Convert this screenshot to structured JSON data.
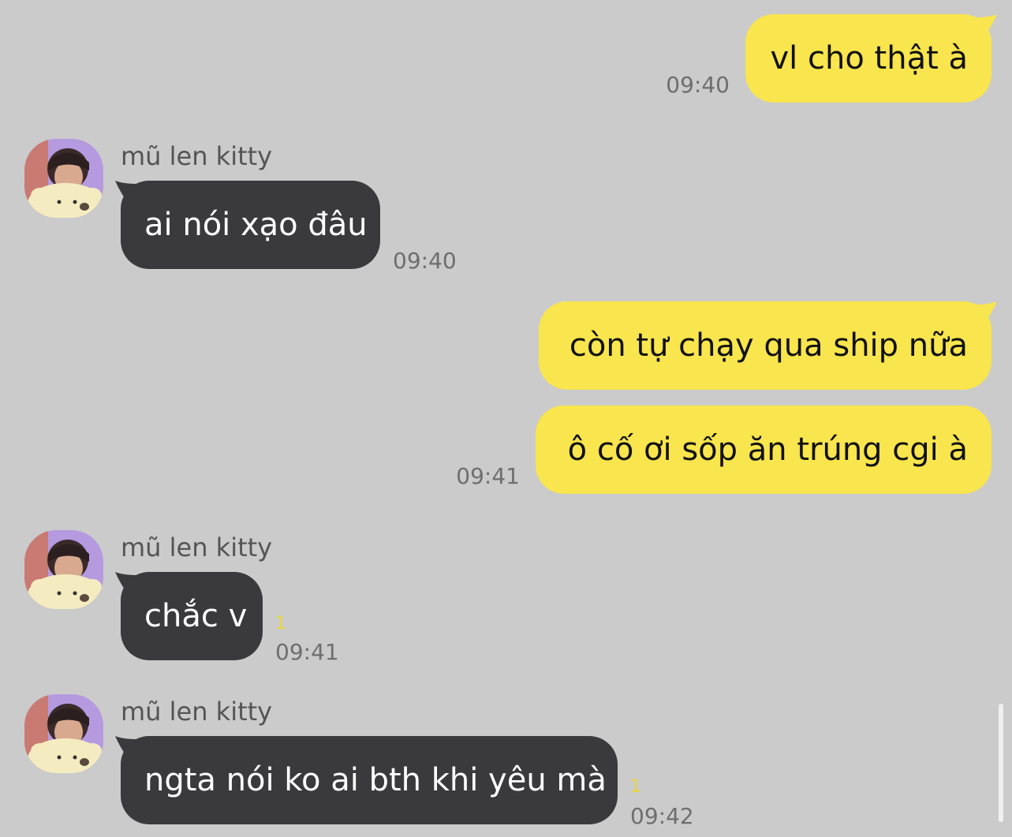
{
  "theme": {
    "background": "#cbcbcb",
    "outgoing_bubble": "#f9e54d",
    "incoming_bubble": "#3a3a3c",
    "outgoing_text": "#111111",
    "incoming_text": "#ffffff",
    "unread_color": "#e9d736"
  },
  "messages": [
    {
      "direction": "outgoing",
      "text": "vl cho thật à",
      "time": "09:40"
    },
    {
      "direction": "incoming",
      "sender": "mũ len kitty",
      "text": "ai nói xạo đâu",
      "time": "09:40",
      "avatar": "avatar-photo"
    },
    {
      "direction": "outgoing",
      "text": "còn tự chạy qua ship nữa",
      "time": ""
    },
    {
      "direction": "outgoing",
      "text": "ô cố ơi sốp ăn trúng cgi à",
      "time": "09:41"
    },
    {
      "direction": "incoming",
      "sender": "mũ len kitty",
      "text": "chắc v",
      "unread": "1",
      "time": "09:41",
      "avatar": "avatar-photo"
    },
    {
      "direction": "incoming",
      "sender": "mũ len kitty",
      "text": "ngta nói ko ai bth khi yêu mà",
      "unread": "1",
      "time": "09:42",
      "avatar": "avatar-photo"
    }
  ]
}
